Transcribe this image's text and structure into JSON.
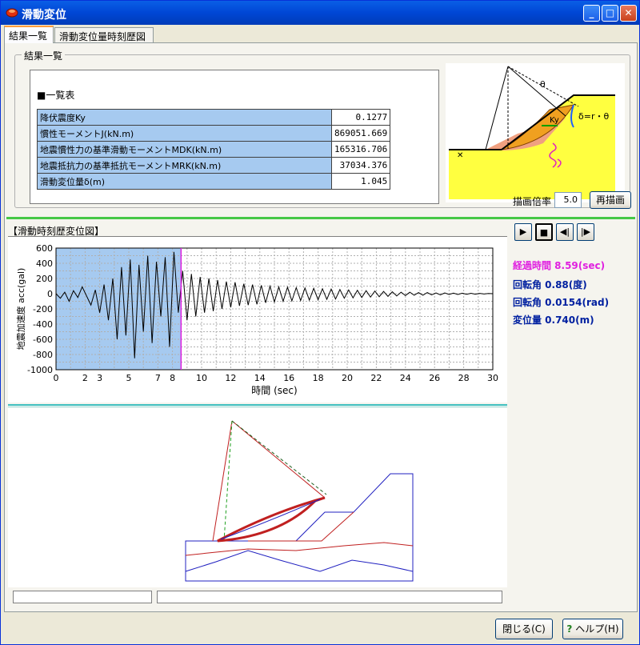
{
  "window": {
    "title": "滑動変位",
    "min": "_",
    "max": "□",
    "close": "✕"
  },
  "tabs": [
    {
      "label": "結果一覧",
      "active": true
    },
    {
      "label": "滑動変位量時刻歴図",
      "active": false
    }
  ],
  "results": {
    "group_label": "結果一覧",
    "table_title": "■一覧表",
    "rows": [
      {
        "label": "降伏震度Ky",
        "value": "0.1277"
      },
      {
        "label": "慣性モーメントJ(kN.m)",
        "value": "869051.669"
      },
      {
        "label": "地震慣性力の基準滑動モーメントMDK(kN.m)",
        "value": "165316.706"
      },
      {
        "label": "地震抵抗力の基準抵抗モーメントMRK(kN.m)",
        "value": "37034.376"
      },
      {
        "label": "滑動変位量δ(m)",
        "value": "1.045"
      }
    ]
  },
  "diagram": {
    "theta": "θ",
    "ky": "Ky",
    "formula": "δ=r・θ"
  },
  "history": {
    "label": "【滑動時刻歴変位図】",
    "chart_data": {
      "type": "line",
      "xlabel": "時間 (sec)",
      "ylabel": "地震加速度 acc(gal)",
      "xlim": [
        0,
        30
      ],
      "ylim": [
        -1000,
        600
      ],
      "xticks": [
        0,
        2,
        3,
        5,
        7,
        8,
        10,
        12,
        14,
        16,
        18,
        20,
        22,
        24,
        26,
        28,
        30
      ],
      "yticks": [
        600,
        400,
        200,
        0,
        -200,
        -400,
        -600,
        -800,
        -1000
      ],
      "elapsed_marker": 8.59,
      "series": [
        {
          "x": [
            0,
            0.3,
            0.6,
            0.9,
            1.2,
            1.5,
            1.8,
            2.1,
            2.4,
            2.7,
            3.0,
            3.3,
            3.6,
            3.9,
            4.2,
            4.5,
            4.8,
            5.1,
            5.4,
            5.7,
            6.0,
            6.3,
            6.6,
            6.9,
            7.2,
            7.5,
            7.8,
            8.1,
            8.4,
            8.7,
            9.0,
            9.3,
            9.6,
            9.9,
            10.2,
            10.5,
            10.8,
            11.1,
            11.4,
            11.7,
            12.0,
            12.3,
            12.6,
            12.9,
            13.2,
            13.5,
            13.8,
            14.1,
            14.4,
            14.7,
            15.0,
            15.3,
            15.6,
            15.9,
            16.2,
            16.5,
            16.8,
            17.1,
            17.4,
            17.7,
            18.0,
            18.3,
            18.6,
            18.9,
            19.2,
            19.5,
            19.8,
            20.1,
            20.4,
            20.7,
            21.0,
            21.3,
            21.6,
            21.9,
            22.2,
            22.5,
            22.8,
            23.1,
            23.4,
            23.7,
            24.0,
            24.3,
            24.6,
            24.9,
            25.2,
            25.5,
            25.8,
            26.1,
            26.4,
            26.7,
            27.0,
            27.3,
            27.6,
            27.9,
            28.2,
            28.5,
            28.8,
            29.1,
            29.4,
            29.7,
            30.0
          ],
          "values": [
            0,
            -60,
            20,
            -100,
            40,
            -50,
            90,
            -30,
            -150,
            50,
            -250,
            120,
            -350,
            200,
            -600,
            350,
            -550,
            450,
            -850,
            380,
            -500,
            500,
            -650,
            420,
            -300,
            480,
            -700,
            550,
            -250,
            300,
            -350,
            260,
            -300,
            220,
            -250,
            200,
            -230,
            180,
            -200,
            160,
            -180,
            150,
            -160,
            130,
            -150,
            120,
            -140,
            110,
            -120,
            100,
            -110,
            90,
            -100,
            85,
            -95,
            80,
            -90,
            75,
            -85,
            70,
            -80,
            65,
            -75,
            60,
            -70,
            55,
            -60,
            50,
            -55,
            45,
            -50,
            40,
            -45,
            35,
            -40,
            30,
            -35,
            25,
            -30,
            20,
            -25,
            20,
            -20,
            15,
            -20,
            15,
            -15,
            10,
            -15,
            10,
            -10,
            8,
            -10,
            6,
            -8,
            5,
            -6,
            4,
            -4,
            2,
            0
          ]
        }
      ]
    }
  },
  "side": {
    "scale_label": "描画倍率",
    "scale_value": "5.0",
    "redraw": "再描画",
    "play": "▶",
    "stop": "■",
    "back": "◀|",
    "fwd": "|▶",
    "elapsed": "経過時間 8.59(sec)",
    "rot_deg": "回転角 0.88(度)",
    "rot_rad": "回転角 0.0154(rad)",
    "disp": "変位量 0.740(m)"
  },
  "colors": {
    "blue_fill": "#a6caf0",
    "magenta": "#e020e0",
    "dark_blue": "#0020a0"
  },
  "footer": {
    "close": "閉じる(C)",
    "help": "ヘルプ(H)"
  }
}
